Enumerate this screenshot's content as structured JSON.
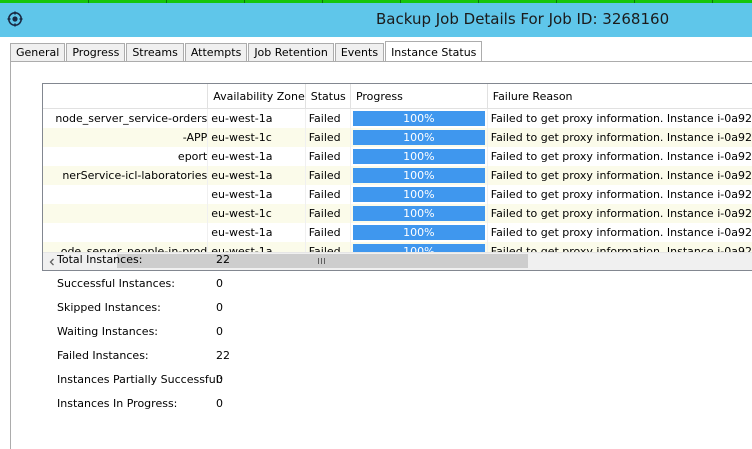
{
  "window": {
    "title": "Backup Job Details For Job ID: 3268160",
    "app_icon": "gear-icon"
  },
  "tabs": [
    {
      "label": "General"
    },
    {
      "label": "Progress"
    },
    {
      "label": "Streams"
    },
    {
      "label": "Attempts"
    },
    {
      "label": "Job Retention"
    },
    {
      "label": "Events"
    },
    {
      "label": "Instance Status",
      "active": true
    }
  ],
  "grid": {
    "columns": [
      "",
      "Availability Zone",
      "Status",
      "Progress",
      "Failure Reason"
    ],
    "rows": [
      {
        "name": "node_server_service-orders",
        "zone": "eu-west-1a",
        "status": "Failed",
        "progress": "100%",
        "progress_fraction": 1.0,
        "reason": "Failed to get proxy information. Instance i-0a92"
      },
      {
        "name": "-APP",
        "zone": "eu-west-1c",
        "status": "Failed",
        "progress": "100%",
        "progress_fraction": 1.0,
        "reason": "Failed to get proxy information. Instance i-0a92"
      },
      {
        "name": "eport",
        "zone": "eu-west-1a",
        "status": "Failed",
        "progress": "100%",
        "progress_fraction": 1.0,
        "reason": "Failed to get proxy information. Instance i-0a92"
      },
      {
        "name": "nerService-icl-laboratories",
        "zone": "eu-west-1a",
        "status": "Failed",
        "progress": "100%",
        "progress_fraction": 1.0,
        "reason": "Failed to get proxy information. Instance i-0a92"
      },
      {
        "name": "",
        "zone": "eu-west-1a",
        "status": "Failed",
        "progress": "100%",
        "progress_fraction": 1.0,
        "reason": "Failed to get proxy information. Instance i-0a92"
      },
      {
        "name": "",
        "zone": "eu-west-1c",
        "status": "Failed",
        "progress": "100%",
        "progress_fraction": 1.0,
        "reason": "Failed to get proxy information. Instance i-0a92"
      },
      {
        "name": "",
        "zone": "eu-west-1a",
        "status": "Failed",
        "progress": "100%",
        "progress_fraction": 1.0,
        "reason": "Failed to get proxy information. Instance i-0a92"
      },
      {
        "name": "ode_server_people-in-prod",
        "zone": "eu-west-1a",
        "status": "Failed",
        "progress": "100%",
        "progress_fraction": 1.0,
        "reason": "Failed to get proxy information. Instance i-0a92"
      }
    ],
    "scrollbar_grip": "III"
  },
  "stats": [
    {
      "label": "Total Instances:",
      "value": "22"
    },
    {
      "label": "Successful Instances:",
      "value": "0"
    },
    {
      "label": "Skipped Instances:",
      "value": "0"
    },
    {
      "label": "Waiting Instances:",
      "value": "0"
    },
    {
      "label": "Failed Instances:",
      "value": "22"
    },
    {
      "label": "Instances Partially Successful:",
      "value": "0"
    },
    {
      "label": "Instances In Progress:",
      "value": "0"
    }
  ],
  "colors": {
    "titlebar": "#5fc6ea",
    "progress_fill": "#3f97ee",
    "alt_row": "#fbfbea",
    "top_stripe": "#16c60c"
  }
}
